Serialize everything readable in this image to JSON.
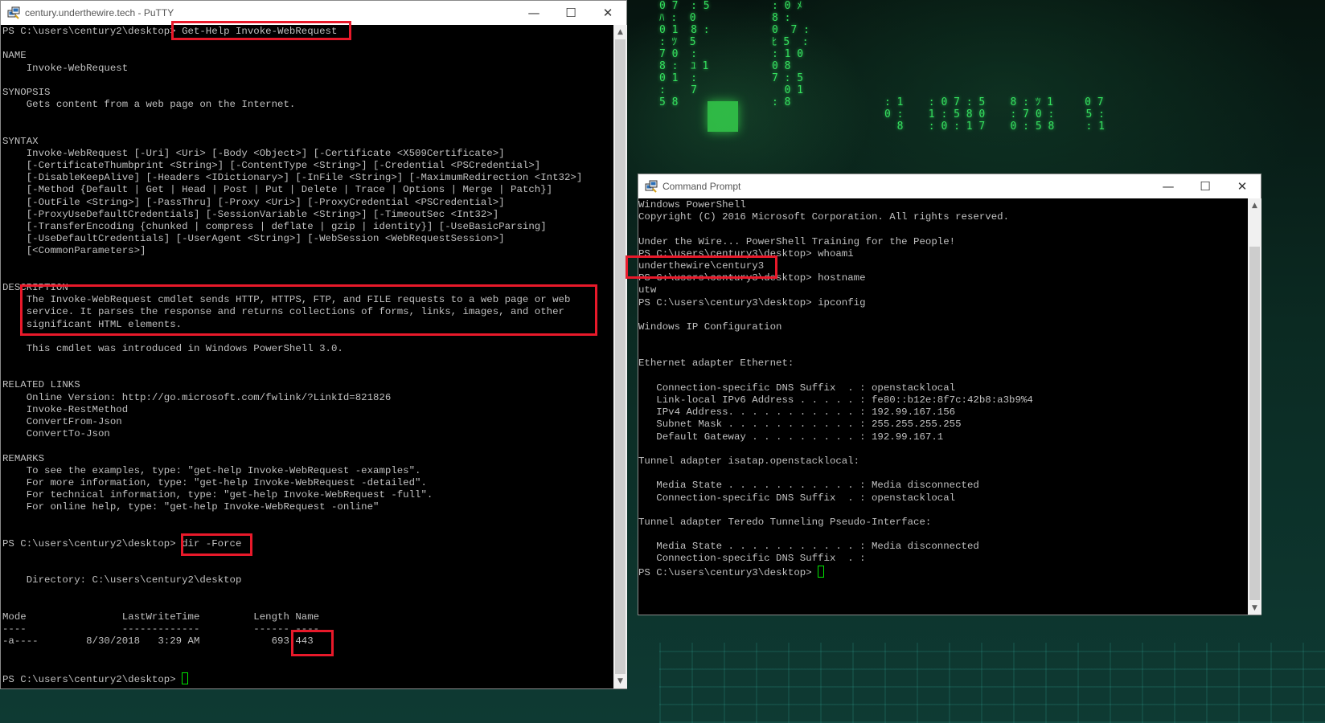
{
  "putty": {
    "title": "century.underthewire.tech - PuTTY",
    "lines": [
      "PS C:\\users\\century2\\desktop> Get-Help Invoke-WebRequest",
      "",
      "NAME",
      "    Invoke-WebRequest",
      "",
      "SYNOPSIS",
      "    Gets content from a web page on the Internet.",
      "",
      "",
      "SYNTAX",
      "    Invoke-WebRequest [-Uri] <Uri> [-Body <Object>] [-Certificate <X509Certificate>]",
      "    [-CertificateThumbprint <String>] [-ContentType <String>] [-Credential <PSCredential>]",
      "    [-DisableKeepAlive] [-Headers <IDictionary>] [-InFile <String>] [-MaximumRedirection <Int32>]",
      "    [-Method {Default | Get | Head | Post | Put | Delete | Trace | Options | Merge | Patch}]",
      "    [-OutFile <String>] [-PassThru] [-Proxy <Uri>] [-ProxyCredential <PSCredential>]",
      "    [-ProxyUseDefaultCredentials] [-SessionVariable <String>] [-TimeoutSec <Int32>]",
      "    [-TransferEncoding {chunked | compress | deflate | gzip | identity}] [-UseBasicParsing]",
      "    [-UseDefaultCredentials] [-UserAgent <String>] [-WebSession <WebRequestSession>]",
      "    [<CommonParameters>]",
      "",
      "",
      "DESCRIPTION",
      "    The Invoke-WebRequest cmdlet sends HTTP, HTTPS, FTP, and FILE requests to a web page or web",
      "    service. It parses the response and returns collections of forms, links, images, and other",
      "    significant HTML elements.",
      "",
      "    This cmdlet was introduced in Windows PowerShell 3.0.",
      "",
      "",
      "RELATED LINKS",
      "    Online Version: http://go.microsoft.com/fwlink/?LinkId=821826",
      "    Invoke-RestMethod",
      "    ConvertFrom-Json",
      "    ConvertTo-Json",
      "",
      "REMARKS",
      "    To see the examples, type: \"get-help Invoke-WebRequest -examples\".",
      "    For more information, type: \"get-help Invoke-WebRequest -detailed\".",
      "    For technical information, type: \"get-help Invoke-WebRequest -full\".",
      "    For online help, type: \"get-help Invoke-WebRequest -online\"",
      "",
      "",
      "PS C:\\users\\century2\\desktop> dir -Force",
      "",
      "",
      "    Directory: C:\\users\\century2\\desktop",
      "",
      "",
      "Mode                LastWriteTime         Length Name",
      "----                -------------         ------ ----",
      "-a----        8/30/2018   3:29 AM            693 443",
      "",
      ""
    ],
    "prompt": "PS C:\\users\\century2\\desktop> "
  },
  "cmd": {
    "title": "Command Prompt",
    "lines": [
      "Windows PowerShell",
      "Copyright (C) 2016 Microsoft Corporation. All rights reserved.",
      "",
      "Under the Wire... PowerShell Training for the People!",
      "PS C:\\users\\century3\\desktop> whoami",
      "underthewire\\century3",
      "PS C:\\users\\century3\\desktop> hostname",
      "utw",
      "PS C:\\users\\century3\\desktop> ipconfig",
      "",
      "Windows IP Configuration",
      "",
      "",
      "Ethernet adapter Ethernet:",
      "",
      "   Connection-specific DNS Suffix  . : openstacklocal",
      "   Link-local IPv6 Address . . . . . : fe80::b12e:8f7c:42b8:a3b9%4",
      "   IPv4 Address. . . . . . . . . . . : 192.99.167.156",
      "   Subnet Mask . . . . . . . . . . . : 255.255.255.255",
      "   Default Gateway . . . . . . . . . : 192.99.167.1",
      "",
      "Tunnel adapter isatap.openstacklocal:",
      "",
      "   Media State . . . . . . . . . . . : Media disconnected",
      "   Connection-specific DNS Suffix  . : openstacklocal",
      "",
      "Tunnel adapter Teredo Tunneling Pseudo-Interface:",
      "",
      "   Media State . . . . . . . . . . . : Media disconnected",
      "   Connection-specific DNS Suffix  . :"
    ],
    "prompt": "PS C:\\users\\century3\\desktop> "
  },
  "window_buttons": {
    "minimize": "—",
    "maximize": "☐",
    "close": "✕"
  },
  "icons": {
    "putty": "putty-icon",
    "cmd": "putty-icon"
  },
  "highlight_color": "#e8192a",
  "cursor_color": "#00e600"
}
